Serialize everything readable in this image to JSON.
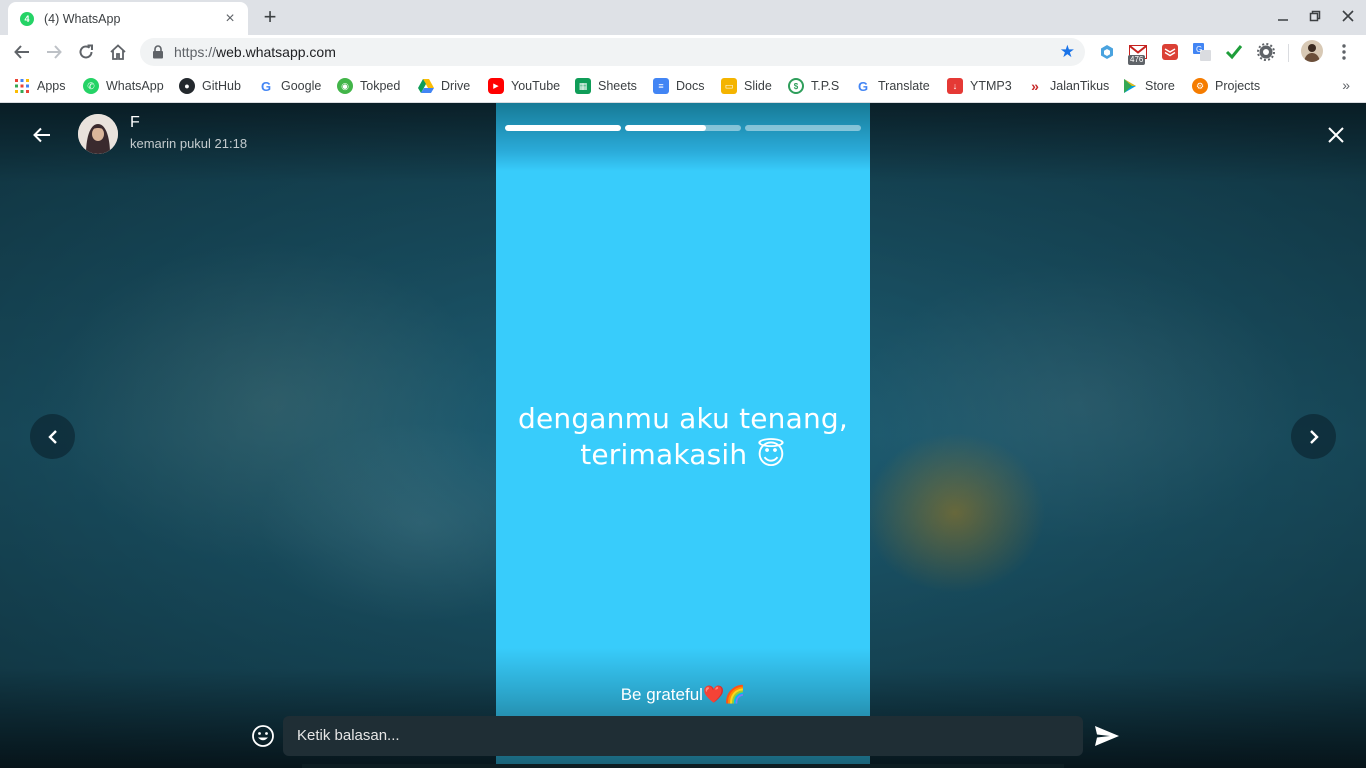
{
  "browser": {
    "tab": {
      "favicon_badge": "4",
      "title": "(4) WhatsApp"
    },
    "url": {
      "scheme": "https://",
      "host": "web.whatsapp.com"
    },
    "extensions": [
      {
        "name": "cube-extension-icon"
      },
      {
        "name": "gmail-icon",
        "badge": "476"
      },
      {
        "name": "todoist-icon"
      },
      {
        "name": "google-translate-extension-icon"
      },
      {
        "name": "checkmark-extension-icon"
      },
      {
        "name": "gear-extension-icon"
      }
    ],
    "bookmarks": [
      {
        "label": "Apps",
        "icon": "apps-grid-icon",
        "color": "#ea4335"
      },
      {
        "label": "WhatsApp",
        "icon": "whatsapp-icon",
        "color": "#25d366"
      },
      {
        "label": "GitHub",
        "icon": "github-icon",
        "color": "#24292e"
      },
      {
        "label": "Google",
        "icon": "google-icon",
        "color": "#4285f4"
      },
      {
        "label": "Tokped",
        "icon": "tokopedia-icon",
        "color": "#42b549"
      },
      {
        "label": "Drive",
        "icon": "drive-icon",
        "color": "#fbbc04"
      },
      {
        "label": "YouTube",
        "icon": "youtube-icon",
        "color": "#ff0000"
      },
      {
        "label": "Sheets",
        "icon": "sheets-icon",
        "color": "#0f9d58"
      },
      {
        "label": "Docs",
        "icon": "docs-icon",
        "color": "#4285f4"
      },
      {
        "label": "Slide",
        "icon": "slides-icon",
        "color": "#f4b400"
      },
      {
        "label": "T.P.S",
        "icon": "tps-icon",
        "color": "#2e9e5b"
      },
      {
        "label": "Translate",
        "icon": "google-icon",
        "color": "#4285f4"
      },
      {
        "label": "YTMP3",
        "icon": "ytmp3-icon",
        "color": "#e53935"
      },
      {
        "label": "JalanTikus",
        "icon": "jalantikus-icon",
        "color": "#c62828"
      },
      {
        "label": "Store",
        "icon": "play-store-icon",
        "color": "#00a0e9"
      },
      {
        "label": "Projects",
        "icon": "projects-icon",
        "color": "#f57c00"
      }
    ],
    "more_bookmarks": "»"
  },
  "status": {
    "contact_name": "F",
    "timestamp": "kemarin pukul 21:18",
    "text_line1": "denganmu aku tenang,",
    "text_line2": "terimakasih 😇",
    "caption": "Be grateful❤️🌈",
    "background_color": "#38ccfb",
    "progress": [
      1.0,
      0.7,
      0.0
    ],
    "reply_placeholder": "Ketik balasan..."
  },
  "colors": {
    "whatsapp_green": "#25d366",
    "accent_blue": "#1a73e8"
  }
}
